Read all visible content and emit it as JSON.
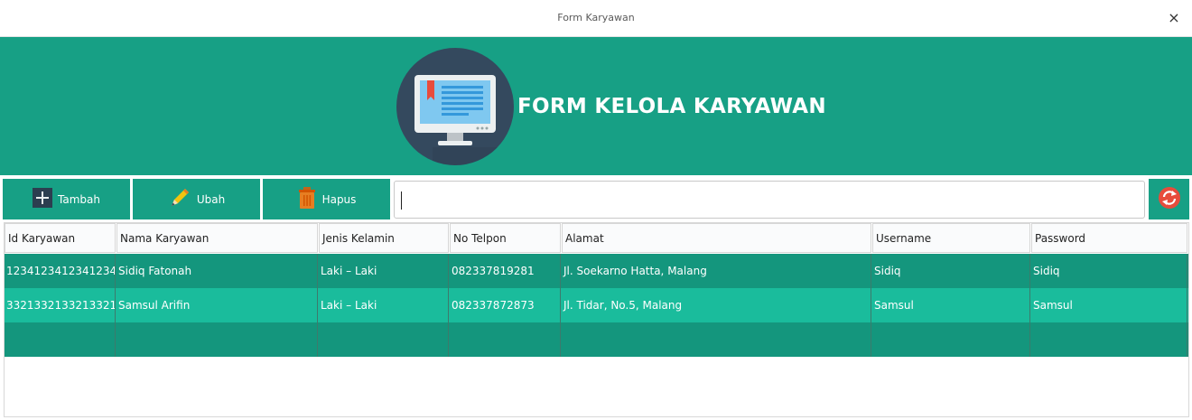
{
  "window": {
    "title": "Form Karyawan",
    "close_glyph": "×"
  },
  "header": {
    "title": "FORM KELOLA KARYAWAN",
    "logo_icon": "monitor-icon"
  },
  "toolbar": {
    "add_label": "Tambah",
    "edit_label": "Ubah",
    "delete_label": "Hapus",
    "search_value": "",
    "refresh_icon": "refresh-icon"
  },
  "table": {
    "columns": [
      "Id Karyawan",
      "Nama Karyawan",
      "Jenis Kelamin",
      "No Telpon",
      "Alamat",
      "Username",
      "Password"
    ],
    "rows": [
      [
        "1234123412341234",
        "Sidiq Fatonah",
        "Laki – Laki",
        "082337819281",
        "Jl. Soekarno Hatta, Malang",
        "Sidiq",
        "Sidiq"
      ],
      [
        "3321332133213321",
        "Samsul Arifin",
        "Laki – Laki",
        "082337872873",
        "Jl. Tidar, No.5, Malang",
        "Samsul",
        "Samsul"
      ],
      [
        "",
        "",
        "",
        "",
        "",
        "",
        ""
      ]
    ]
  },
  "colors": {
    "accent": "#17a085",
    "row_dark": "#14967d",
    "row_light": "#1abc9c",
    "logo_bg": "#34495e",
    "refresh": "#e74c3c"
  }
}
